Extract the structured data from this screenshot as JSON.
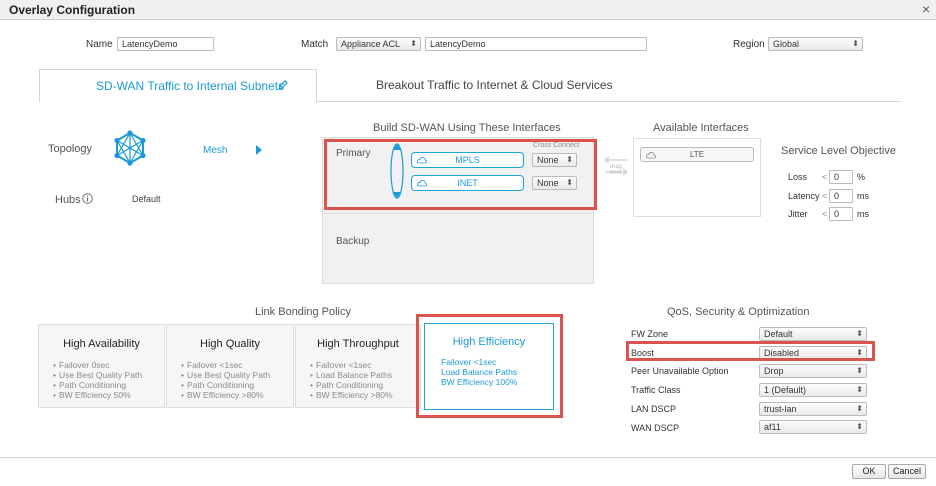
{
  "window": {
    "title": "Overlay Configuration",
    "close_glyph": "×"
  },
  "form": {
    "name_label": "Name",
    "name_value": "LatencyDemo",
    "match_label": "Match",
    "match_select": "Appliance ACL",
    "match_value": "LatencyDemo",
    "region_label": "Region",
    "region_select": "Global"
  },
  "tabs": [
    {
      "label": "SD-WAN Traffic to Internal Subnets",
      "active": true
    },
    {
      "label": "Breakout Traffic to Internet & Cloud Services",
      "active": false
    }
  ],
  "topology": {
    "label": "Topology",
    "mode": "Mesh",
    "hubs_label": "Hubs",
    "hubs_value": "Default"
  },
  "build": {
    "title": "Build SD-WAN Using These Interfaces",
    "primary_label": "Primary",
    "cross_connect_label": "Cross Connect",
    "interfaces": [
      {
        "name": "MPLS",
        "cross": "None"
      },
      {
        "name": "INET",
        "cross": "None"
      }
    ],
    "backup_label": "Backup",
    "drag_hint": "drag here"
  },
  "available": {
    "title": "Available Interfaces",
    "interfaces": [
      "LTE"
    ]
  },
  "slo": {
    "title": "Service Level Objective",
    "rows": [
      {
        "label": "Loss",
        "op": "<",
        "value": "0",
        "unit": "%"
      },
      {
        "label": "Latency",
        "op": "<",
        "value": "0",
        "unit": "ms"
      },
      {
        "label": "Jitter",
        "op": "<",
        "value": "0",
        "unit": "ms"
      }
    ]
  },
  "bonding": {
    "title": "Link Bonding Policy",
    "policies": [
      {
        "name": "High Availability",
        "items": [
          "Failover 0sec",
          "Use Best Quality Path",
          "Path Conditioning",
          "BW Efficiency 50%"
        ]
      },
      {
        "name": "High Quality",
        "items": [
          "Failover <1sec",
          "Use Best Quality Path",
          "Path Conditioning",
          "BW Efficiency >80%"
        ]
      },
      {
        "name": "High Throughput",
        "items": [
          "Failover <1sec",
          "Load Balance Paths",
          "Path Conditioning",
          "BW Efficiency >80%"
        ]
      },
      {
        "name": "High Efficiency",
        "items": [
          "Failover <1sec",
          "Load Balance Paths",
          "BW Efficiency 100%"
        ],
        "selected": true
      }
    ]
  },
  "qos": {
    "title": "QoS, Security & Optimization",
    "rows": [
      {
        "label": "FW Zone",
        "value": "Default"
      },
      {
        "label": "Boost",
        "value": "Disabled"
      },
      {
        "label": "Peer Unavailable Option",
        "value": "Drop"
      },
      {
        "label": "Traffic Class",
        "value": "1 (Default)"
      },
      {
        "label": "LAN DSCP",
        "value": "trust-lan"
      },
      {
        "label": "WAN DSCP",
        "value": "af11"
      }
    ]
  },
  "footer": {
    "ok": "OK",
    "cancel": "Cancel"
  },
  "colors": {
    "accent": "#1a9ad6",
    "highlight": "#d9534f"
  }
}
